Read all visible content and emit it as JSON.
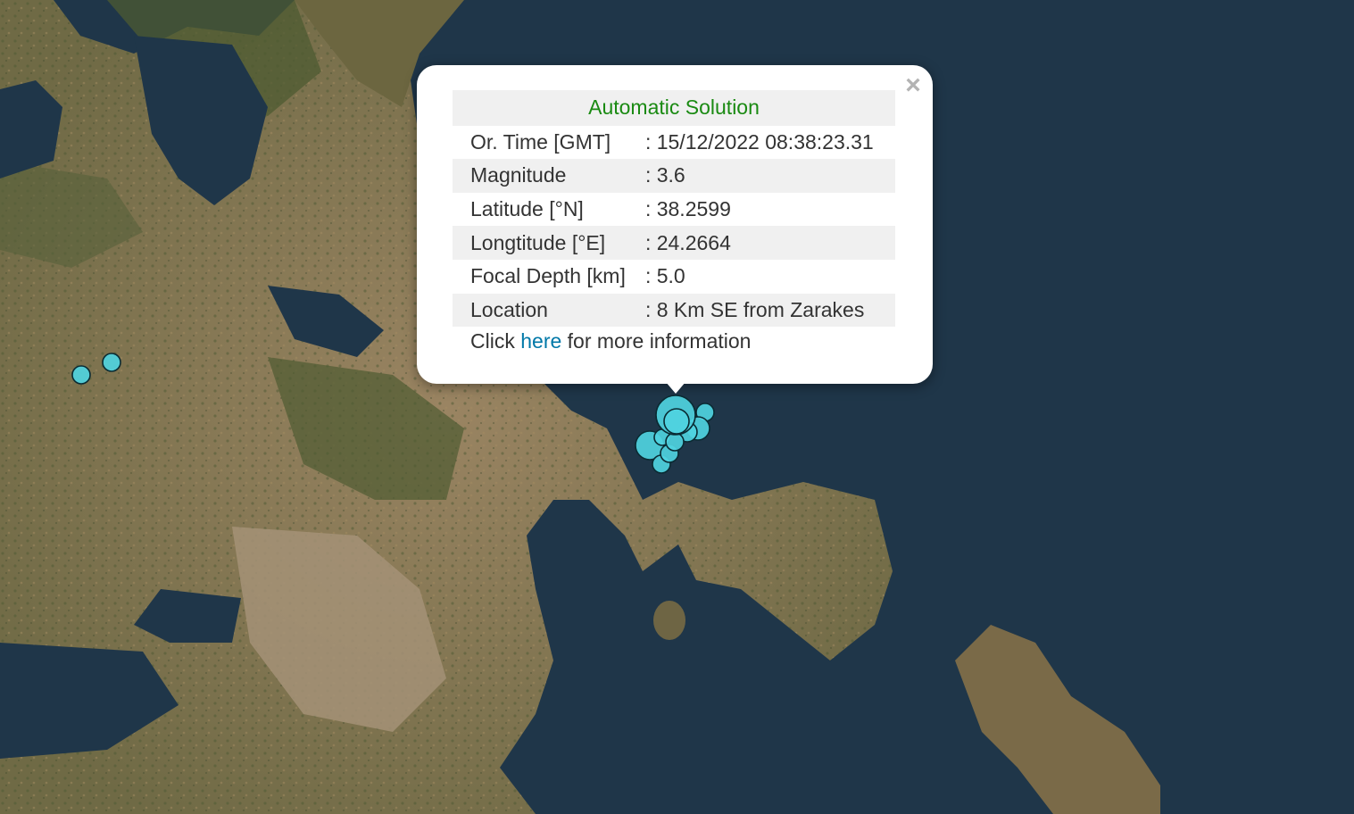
{
  "popup": {
    "close_label": "×",
    "title": "Automatic Solution",
    "rows": [
      {
        "label": "Or. Time [GMT]",
        "value": ": 15/12/2022 08:38:23.31"
      },
      {
        "label": "Magnitude",
        "value": ": 3.6"
      },
      {
        "label": "Latitude [°N]",
        "value": ": 38.2599"
      },
      {
        "label": "Longtitude [°E]",
        "value": ": 24.2664"
      },
      {
        "label": "Focal Depth [km]",
        "value": ": 5.0"
      },
      {
        "label": "Location",
        "value": ": 8 Km SE from Zarakes"
      }
    ],
    "more_prefix": "Click",
    "more_link": "here",
    "more_suffix": "for more information"
  },
  "map": {
    "marker_color": "#4fd3df",
    "marker_stroke": "#0a2b33",
    "sea_color": "#1e3447",
    "land_color": "#8a7451"
  }
}
